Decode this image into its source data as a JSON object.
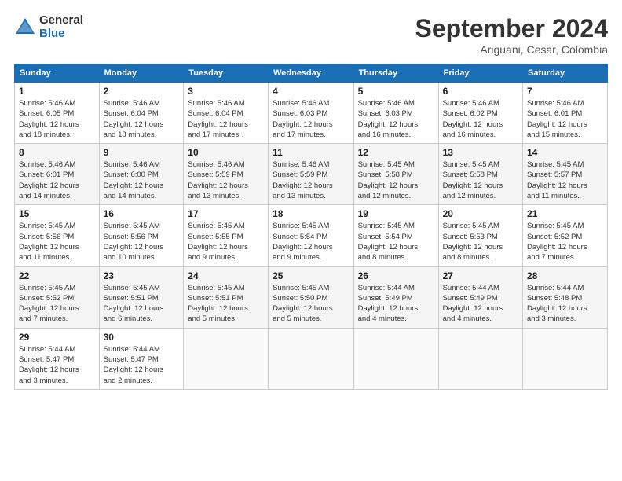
{
  "logo": {
    "general": "General",
    "blue": "Blue"
  },
  "header": {
    "title": "September 2024",
    "subtitle": "Ariguani, Cesar, Colombia"
  },
  "weekdays": [
    "Sunday",
    "Monday",
    "Tuesday",
    "Wednesday",
    "Thursday",
    "Friday",
    "Saturday"
  ],
  "weeks": [
    [
      {
        "day": "1",
        "info": "Sunrise: 5:46 AM\nSunset: 6:05 PM\nDaylight: 12 hours\nand 18 minutes."
      },
      {
        "day": "2",
        "info": "Sunrise: 5:46 AM\nSunset: 6:04 PM\nDaylight: 12 hours\nand 18 minutes."
      },
      {
        "day": "3",
        "info": "Sunrise: 5:46 AM\nSunset: 6:04 PM\nDaylight: 12 hours\nand 17 minutes."
      },
      {
        "day": "4",
        "info": "Sunrise: 5:46 AM\nSunset: 6:03 PM\nDaylight: 12 hours\nand 17 minutes."
      },
      {
        "day": "5",
        "info": "Sunrise: 5:46 AM\nSunset: 6:03 PM\nDaylight: 12 hours\nand 16 minutes."
      },
      {
        "day": "6",
        "info": "Sunrise: 5:46 AM\nSunset: 6:02 PM\nDaylight: 12 hours\nand 16 minutes."
      },
      {
        "day": "7",
        "info": "Sunrise: 5:46 AM\nSunset: 6:01 PM\nDaylight: 12 hours\nand 15 minutes."
      }
    ],
    [
      {
        "day": "8",
        "info": "Sunrise: 5:46 AM\nSunset: 6:01 PM\nDaylight: 12 hours\nand 14 minutes."
      },
      {
        "day": "9",
        "info": "Sunrise: 5:46 AM\nSunset: 6:00 PM\nDaylight: 12 hours\nand 14 minutes."
      },
      {
        "day": "10",
        "info": "Sunrise: 5:46 AM\nSunset: 5:59 PM\nDaylight: 12 hours\nand 13 minutes."
      },
      {
        "day": "11",
        "info": "Sunrise: 5:46 AM\nSunset: 5:59 PM\nDaylight: 12 hours\nand 13 minutes."
      },
      {
        "day": "12",
        "info": "Sunrise: 5:45 AM\nSunset: 5:58 PM\nDaylight: 12 hours\nand 12 minutes."
      },
      {
        "day": "13",
        "info": "Sunrise: 5:45 AM\nSunset: 5:58 PM\nDaylight: 12 hours\nand 12 minutes."
      },
      {
        "day": "14",
        "info": "Sunrise: 5:45 AM\nSunset: 5:57 PM\nDaylight: 12 hours\nand 11 minutes."
      }
    ],
    [
      {
        "day": "15",
        "info": "Sunrise: 5:45 AM\nSunset: 5:56 PM\nDaylight: 12 hours\nand 11 minutes."
      },
      {
        "day": "16",
        "info": "Sunrise: 5:45 AM\nSunset: 5:56 PM\nDaylight: 12 hours\nand 10 minutes."
      },
      {
        "day": "17",
        "info": "Sunrise: 5:45 AM\nSunset: 5:55 PM\nDaylight: 12 hours\nand 9 minutes."
      },
      {
        "day": "18",
        "info": "Sunrise: 5:45 AM\nSunset: 5:54 PM\nDaylight: 12 hours\nand 9 minutes."
      },
      {
        "day": "19",
        "info": "Sunrise: 5:45 AM\nSunset: 5:54 PM\nDaylight: 12 hours\nand 8 minutes."
      },
      {
        "day": "20",
        "info": "Sunrise: 5:45 AM\nSunset: 5:53 PM\nDaylight: 12 hours\nand 8 minutes."
      },
      {
        "day": "21",
        "info": "Sunrise: 5:45 AM\nSunset: 5:52 PM\nDaylight: 12 hours\nand 7 minutes."
      }
    ],
    [
      {
        "day": "22",
        "info": "Sunrise: 5:45 AM\nSunset: 5:52 PM\nDaylight: 12 hours\nand 7 minutes."
      },
      {
        "day": "23",
        "info": "Sunrise: 5:45 AM\nSunset: 5:51 PM\nDaylight: 12 hours\nand 6 minutes."
      },
      {
        "day": "24",
        "info": "Sunrise: 5:45 AM\nSunset: 5:51 PM\nDaylight: 12 hours\nand 5 minutes."
      },
      {
        "day": "25",
        "info": "Sunrise: 5:45 AM\nSunset: 5:50 PM\nDaylight: 12 hours\nand 5 minutes."
      },
      {
        "day": "26",
        "info": "Sunrise: 5:44 AM\nSunset: 5:49 PM\nDaylight: 12 hours\nand 4 minutes."
      },
      {
        "day": "27",
        "info": "Sunrise: 5:44 AM\nSunset: 5:49 PM\nDaylight: 12 hours\nand 4 minutes."
      },
      {
        "day": "28",
        "info": "Sunrise: 5:44 AM\nSunset: 5:48 PM\nDaylight: 12 hours\nand 3 minutes."
      }
    ],
    [
      {
        "day": "29",
        "info": "Sunrise: 5:44 AM\nSunset: 5:47 PM\nDaylight: 12 hours\nand 3 minutes."
      },
      {
        "day": "30",
        "info": "Sunrise: 5:44 AM\nSunset: 5:47 PM\nDaylight: 12 hours\nand 2 minutes."
      },
      null,
      null,
      null,
      null,
      null
    ]
  ]
}
